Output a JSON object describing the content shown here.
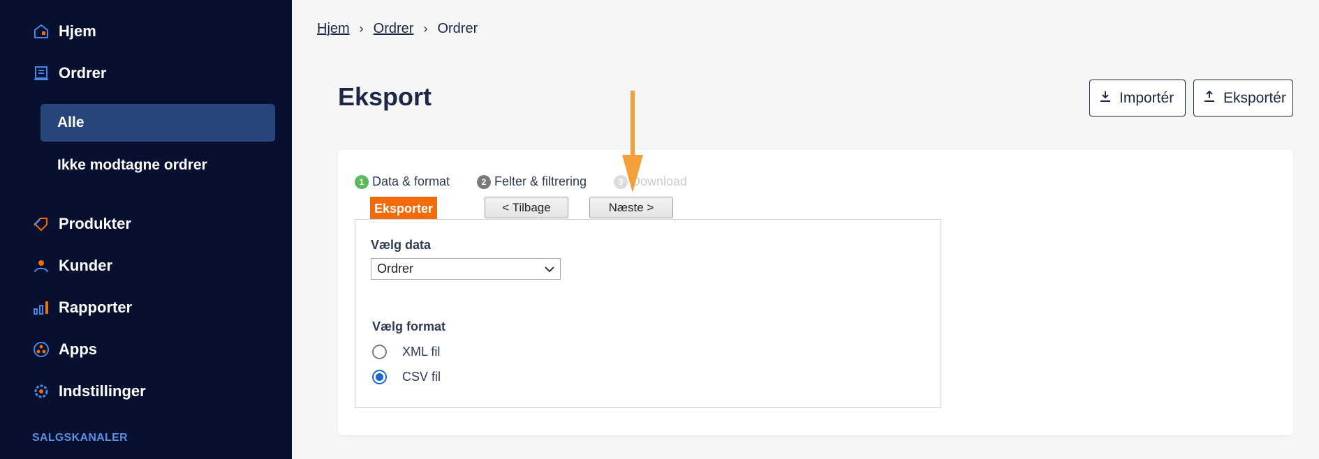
{
  "sidebar": {
    "items": [
      {
        "label": "Hjem",
        "icon": "home-icon"
      },
      {
        "label": "Ordrer",
        "icon": "orders-icon"
      },
      {
        "label": "Produkter",
        "icon": "tag-icon"
      },
      {
        "label": "Kunder",
        "icon": "person-icon"
      },
      {
        "label": "Rapporter",
        "icon": "bar-chart-icon"
      },
      {
        "label": "Apps",
        "icon": "apps-icon"
      },
      {
        "label": "Indstillinger",
        "icon": "gear-icon"
      }
    ],
    "subitems": [
      {
        "label": "Alle",
        "active": true
      },
      {
        "label": "Ikke modtagne ordrer",
        "active": false
      }
    ],
    "section_label": "SALGSKANALER",
    "colors": {
      "background": "#07102f",
      "active": "#27457a",
      "accent": "#f26a0a"
    }
  },
  "breadcrumb": {
    "items": [
      "Hjem",
      "Ordrer",
      "Ordrer"
    ]
  },
  "page": {
    "title": "Eksport",
    "import_label": "Importér",
    "export_label": "Eksportér"
  },
  "wizard": {
    "steps": [
      {
        "num": "1",
        "label": "Data & format",
        "color": "#5cb85c"
      },
      {
        "num": "2",
        "label": "Felter & filtrering",
        "color": "#7a7a7a"
      },
      {
        "num": "3",
        "label": "Download",
        "color": "#dcdcdc"
      }
    ],
    "tab_label": "Eksporter",
    "back_label": "< Tilbage",
    "next_label": "Næste >",
    "select_data_label": "Vælg data",
    "select_data_value": "Ordrer",
    "select_format_label": "Vælg format",
    "formats": [
      {
        "label": "XML fil",
        "checked": false
      },
      {
        "label": "CSV fil",
        "checked": true
      }
    ]
  }
}
